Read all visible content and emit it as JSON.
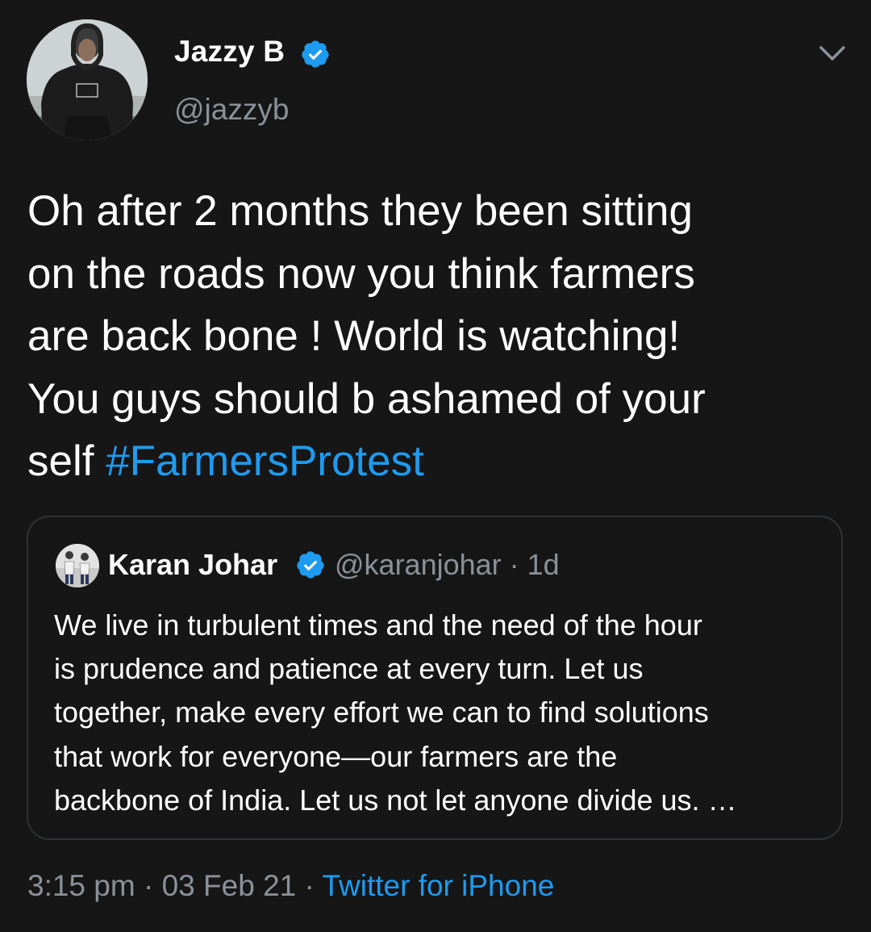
{
  "author": {
    "name": "Jazzy B",
    "handle": "@jazzyb",
    "verified": true
  },
  "tweet": {
    "lines": [
      "Oh after 2 months they been sitting",
      "on the roads now you think farmers",
      "are back bone ! World is watching!",
      "You guys should b ashamed of your"
    ],
    "last_line_prefix": "self ",
    "hashtag": "#FarmersProtest"
  },
  "quoted_tweet": {
    "name": "Karan Johar",
    "handle": "@karanjohar",
    "separator": " · ",
    "age": "1d",
    "verified": true,
    "lines": [
      "We live in turbulent times and the need of the hour",
      "is prudence and patience at every turn. Let us",
      "together, make every effort we can to find solutions",
      "that work for everyone—our farmers are the",
      "backbone of India. Let us not let anyone divide us. …"
    ]
  },
  "footer": {
    "time": "3:15 pm",
    "sep1": " · ",
    "date": "03 Feb 21",
    "sep2": " · ",
    "source": "Twitter for iPhone"
  },
  "colors": {
    "background": "#161616",
    "link": "#1d9bf0",
    "muted": "#8b9199",
    "border": "#2f3336"
  },
  "icons": {
    "verified": "verified-badge-icon",
    "menu": "chevron-down-icon"
  }
}
